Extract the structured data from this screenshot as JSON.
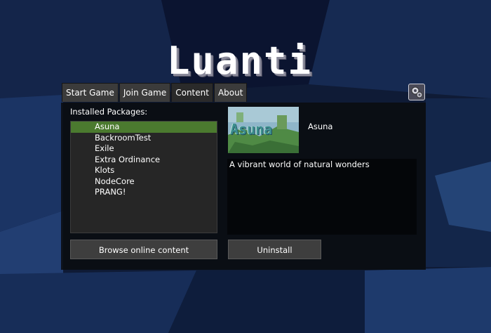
{
  "app": {
    "logo_text": "Luanti"
  },
  "tabs": [
    {
      "label": "Start Game",
      "active": false
    },
    {
      "label": "Join Game",
      "active": false
    },
    {
      "label": "Content",
      "active": true
    },
    {
      "label": "About",
      "active": false
    }
  ],
  "settings": {
    "icon": "gears-icon"
  },
  "packages": {
    "label": "Installed Packages:",
    "items": [
      "Asuna",
      "BackroomTest",
      "Exile",
      "Extra Ordinance",
      "Klots",
      "NodeCore",
      "PRANG!"
    ],
    "selected": "Asuna"
  },
  "detail": {
    "thumbnail_text": "Asuna",
    "name": "Asuna",
    "description": "A vibrant world of natural wonders"
  },
  "buttons": {
    "browse": "Browse online content",
    "uninstall": "Uninstall"
  },
  "colors": {
    "selection": "#4b7a2f",
    "background": "#0e1a35"
  }
}
